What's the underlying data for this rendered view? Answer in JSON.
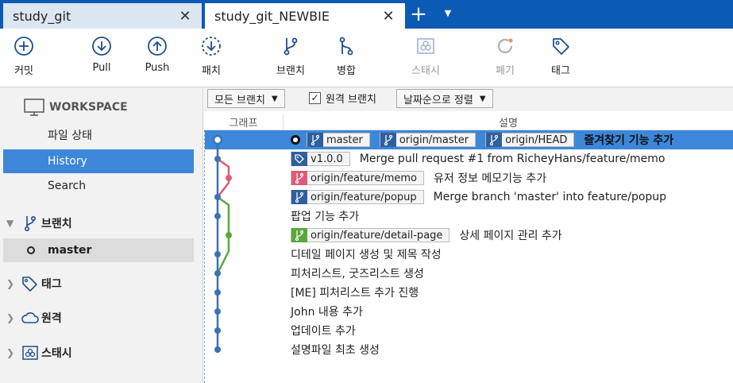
{
  "tabs": [
    {
      "title": "study_git",
      "active": false
    },
    {
      "title": "study_git_NEWBIE",
      "active": true
    }
  ],
  "tab_close_glyph": "✕",
  "new_tab_glyph": "+",
  "tab_menu_glyph": "▼",
  "toolbar": {
    "commit": "커밋",
    "pull": "Pull",
    "push": "Push",
    "fetch": "패치",
    "branch": "브랜치",
    "merge": "병합",
    "stash": "스태시",
    "discard": "폐기",
    "tag": "태그"
  },
  "sidebar": {
    "workspace": "WORKSPACE",
    "items": [
      "파일 상태",
      "History",
      "Search"
    ],
    "branches_label": "브랜치",
    "current_branch": "master",
    "tags_label": "태그",
    "remotes_label": "원격",
    "stashes_label": "스태시"
  },
  "filter": {
    "branch_select": "모든 브랜치",
    "remote_checkbox": "원격 브랜치",
    "sort_select": "날짜순으로 정렬"
  },
  "columns": {
    "graph": "그래프",
    "description": "설명"
  },
  "commits": [
    {
      "refs": [
        {
          "label": "master",
          "type": "branch",
          "color": "#2f5f9e"
        },
        {
          "label": "origin/master",
          "type": "branch",
          "color": "#2f5f9e"
        },
        {
          "label": "origin/HEAD",
          "type": "branch",
          "color": "#2f5f9e"
        }
      ],
      "message": "즐겨찾기 기능 추가",
      "selected": true
    },
    {
      "refs": [
        {
          "label": "v1.0.0",
          "type": "tag",
          "color": "#2f5f9e"
        }
      ],
      "message": "Merge pull request #1 from RicheyHans/feature/memo"
    },
    {
      "refs": [
        {
          "label": "origin/feature/memo",
          "type": "branch",
          "color": "#e05a78"
        }
      ],
      "message": "유저 정보 메모기능 추가"
    },
    {
      "refs": [
        {
          "label": "origin/feature/popup",
          "type": "branch",
          "color": "#2f5f9e"
        }
      ],
      "message": "Merge branch 'master' into feature/popup"
    },
    {
      "refs": [],
      "message": "팝업 기능 추가"
    },
    {
      "refs": [
        {
          "label": "origin/feature/detail-page",
          "type": "branch",
          "color": "#5aa83c"
        }
      ],
      "message": "상세 페이지 관리 추가"
    },
    {
      "refs": [],
      "message": "디테일 페이지 생성 및 제목 작성"
    },
    {
      "refs": [],
      "message": "피처리스트, 굿즈리스트 생성"
    },
    {
      "refs": [],
      "message": "[ME] 피처리스트 추가 진행"
    },
    {
      "refs": [],
      "message": "John 내용 추가"
    },
    {
      "refs": [],
      "message": "업데이트 추가"
    },
    {
      "refs": [],
      "message": "설명파일 최초 생성"
    }
  ],
  "colors": {
    "accent": "#0b5bb5",
    "selection": "#3c87d9",
    "graph_main": "#3a73b4",
    "graph_memo": "#e05a78",
    "graph_detail": "#5aa83c"
  }
}
